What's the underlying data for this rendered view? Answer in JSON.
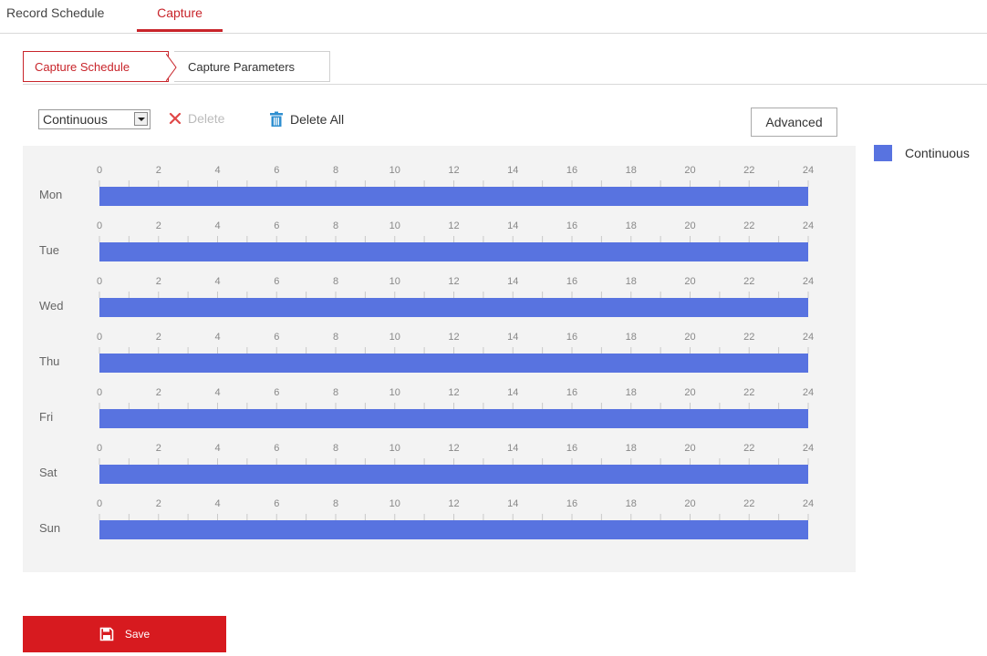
{
  "top_tabs": [
    {
      "label": "Record Schedule",
      "active": false
    },
    {
      "label": "Capture",
      "active": true
    }
  ],
  "sub_tabs": [
    {
      "label": "Capture Schedule",
      "active": true
    },
    {
      "label": "Capture Parameters",
      "active": false
    }
  ],
  "toolbar": {
    "select_value": "Continuous",
    "delete_label": "Delete",
    "delete_all_label": "Delete All",
    "advanced_label": "Advanced"
  },
  "legend": {
    "label": "Continuous",
    "color": "#5873e0"
  },
  "schedule": {
    "hour_labels": [
      "0",
      "2",
      "4",
      "6",
      "8",
      "10",
      "12",
      "14",
      "16",
      "18",
      "20",
      "22",
      "24"
    ],
    "days": [
      {
        "label": "Mon",
        "start": 0,
        "end": 24
      },
      {
        "label": "Tue",
        "start": 0,
        "end": 24
      },
      {
        "label": "Wed",
        "start": 0,
        "end": 24
      },
      {
        "label": "Thu",
        "start": 0,
        "end": 24
      },
      {
        "label": "Fri",
        "start": 0,
        "end": 24
      },
      {
        "label": "Sat",
        "start": 0,
        "end": 24
      },
      {
        "label": "Sun",
        "start": 0,
        "end": 24
      }
    ]
  },
  "save_button": {
    "label": "Save"
  },
  "colors": {
    "accent": "#c8242a",
    "bar": "#5873e0",
    "save_bg": "#d71a1f"
  }
}
